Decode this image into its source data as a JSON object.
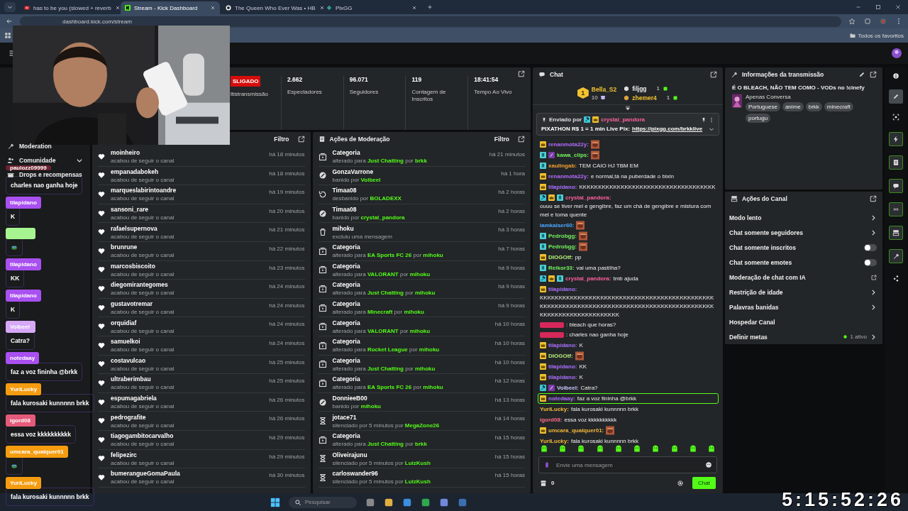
{
  "browser": {
    "tabs": [
      {
        "title": "has to be you (slowed + reverb",
        "selected": false
      },
      {
        "title": "Stream - Kick Dashboard",
        "selected": true
      },
      {
        "title": "The Queen Who Ever Was • HB",
        "selected": false
      },
      {
        "title": "PixGG",
        "selected": false
      }
    ],
    "url": "dashboard.kick.com/stream",
    "bookmarks_label": "Todos os favoritos"
  },
  "sidebar": {
    "items": [
      {
        "label": "Moderation",
        "expandable": false
      },
      {
        "label": "Comunidade",
        "expandable": true
      },
      {
        "label": "Drops e recompensas",
        "expandable": false
      }
    ]
  },
  "stats": {
    "status": {
      "label": "SLIGADO",
      "live": false
    },
    "status_note": "ltistransmissão",
    "items": [
      {
        "value": "2.662",
        "label": "Espectadores"
      },
      {
        "value": "96.071",
        "label": "Seguidores"
      },
      {
        "value": "119",
        "label": "Contagem de Inscritos"
      },
      {
        "value": "18:41:54",
        "label": "Tempo Ao Vivo"
      }
    ]
  },
  "activity": {
    "filter": "Filtro",
    "rows": [
      {
        "user": "moinheiro",
        "action": "acabou de seguir o canal",
        "time": "há 18 minutos"
      },
      {
        "user": "empanadabokeh",
        "action": "acabou de seguir o canal",
        "time": "há 18 minutos"
      },
      {
        "user": "marqueslabirintoandre",
        "action": "acabou de seguir o canal",
        "time": "há 19 minutos"
      },
      {
        "user": "sansoni_rare",
        "action": "acabou de seguir o canal",
        "time": "há 20 minutos"
      },
      {
        "user": "rafaelsupernova",
        "action": "acabou de seguir o canal",
        "time": "há 21 minutos"
      },
      {
        "user": "brunrune",
        "action": "acabou de seguir o canal",
        "time": "há 22 minutos"
      },
      {
        "user": "marcosbiscoito",
        "action": "acabou de seguir o canal",
        "time": "há 23 minutos"
      },
      {
        "user": "diegomirantegomes",
        "action": "acabou de seguir o canal",
        "time": "há 24 minutos"
      },
      {
        "user": "gustavotremar",
        "action": "acabou de seguir o canal",
        "time": "há 24 minutos"
      },
      {
        "user": "orquidiaf",
        "action": "acabou de seguir o canal",
        "time": "há 24 minutos"
      },
      {
        "user": "samuelkoi",
        "action": "acabou de seguir o canal",
        "time": "há 24 minutos"
      },
      {
        "user": "costavulcao",
        "action": "acabou de seguir o canal",
        "time": "há 25 minutos"
      },
      {
        "user": "ultraberimbau",
        "action": "acabou de seguir o canal",
        "time": "há 25 minutos"
      },
      {
        "user": "espumagabriela",
        "action": "acabou de seguir o canal",
        "time": "há 26 minutos"
      },
      {
        "user": "pedrografite",
        "action": "acabou de seguir o canal",
        "time": "há 26 minutos"
      },
      {
        "user": "tiagogambitocarvalho",
        "action": "acabou de seguir o canal",
        "time": "há 29 minutos"
      },
      {
        "user": "felipezirc",
        "action": "acabou de seguir o canal",
        "time": "há 29 minutos"
      },
      {
        "user": "bumerangueGomaPaula",
        "action": "acabou de seguir o canal",
        "time": "há 30 minutos"
      }
    ]
  },
  "moderation": {
    "title": "Ações de Moderação",
    "filter": "Filtro",
    "rows": [
      {
        "kind": "category",
        "title": "Categoria",
        "detail": "alterado para **Just Chatting** por **brkk**",
        "time": "há 21 minutos"
      },
      {
        "kind": "ban",
        "title": "GonzaVarrone",
        "detail": "banido por **Volbeel**",
        "time": "há 1 hora"
      },
      {
        "kind": "unban",
        "title": "Timaa08",
        "detail": "desbanido por **BOLADEXX**",
        "time": "há 2 horas"
      },
      {
        "kind": "ban",
        "title": "Timaa08",
        "detail": "banido por **crystal_pandora**",
        "time": "há 2 horas"
      },
      {
        "kind": "delete",
        "title": "mihoku",
        "detail": "excluiu uma mensagem",
        "time": "há 3 horas"
      },
      {
        "kind": "category",
        "title": "Categoria",
        "detail": "alterado para **EA Sports FC 26** por **mihoku**",
        "time": "há 7 horas"
      },
      {
        "kind": "category",
        "title": "Categoria",
        "detail": "alterado para **VALORANT** por **mihoku**",
        "time": "há 9 horas"
      },
      {
        "kind": "category",
        "title": "Categoria",
        "detail": "alterado para **Just Chatting** por **mihoku**",
        "time": "há 9 horas"
      },
      {
        "kind": "category",
        "title": "Categoria",
        "detail": "alterado para **Minecraft** por **mihoku**",
        "time": "há 9 horas"
      },
      {
        "kind": "category",
        "title": "Categoria",
        "detail": "alterado para **VALORANT** por **mihoku**",
        "time": "há 10 horas"
      },
      {
        "kind": "category",
        "title": "Categoria",
        "detail": "alterado para **Rocket League** por **mihoku**",
        "time": "há 10 horas"
      },
      {
        "kind": "category",
        "title": "Categoria",
        "detail": "alterado para **Just Chatting** por **mihoku**",
        "time": "há 10 horas"
      },
      {
        "kind": "category",
        "title": "Categoria",
        "detail": "alterado para **EA Sports FC 26** por **mihoku**",
        "time": "há 12 horas"
      },
      {
        "kind": "ban",
        "title": "DonnieeB00",
        "detail": "banido por **mihoku**",
        "time": "há 13 horas"
      },
      {
        "kind": "timeout",
        "title": "jotace71",
        "detail": "silenciado por 5 minutos por **MegaZone26**",
        "time": "há 14 horas"
      },
      {
        "kind": "category",
        "title": "Categoria",
        "detail": "alterado para **Just Chatting** por **brkk**",
        "time": "há 15 horas"
      },
      {
        "kind": "timeout",
        "title": "Oliveirajunu",
        "detail": "silenciado por 5 minutos por **LuizKush**",
        "time": "há 15 horas"
      },
      {
        "kind": "timeout",
        "title": "carloswander96",
        "detail": "silenciado por 5 minutos por **LuizKush**",
        "time": "há 15 horas"
      }
    ]
  },
  "chat": {
    "title": "Chat",
    "leaderboard": [
      {
        "rank": "1",
        "user": "Bella_S2",
        "count": "10"
      },
      {
        "user": "filjgg",
        "count": "1"
      },
      {
        "user": "zhemer4",
        "count": "1"
      }
    ],
    "pinned": {
      "label": "Enviado por",
      "badges": [
        {
          "kind": "mod"
        },
        {
          "kind": "crown"
        }
      ],
      "user": "crystal_pandora",
      "color": "#ff5fa0",
      "text": "PIXATHON R$ 1 = 1 min Live Pix:",
      "link": "https://pixgg.com/brkklive"
    },
    "messages": [
      {
        "badges": [
          {
            "kind": "crown"
          }
        ],
        "user": "renanmota22y:",
        "color": "#b36bff",
        "emote": true,
        "highlighted": false
      },
      {
        "badges": [
          {
            "kind": "sub"
          },
          {
            "kind": "other"
          }
        ],
        "user": "kawa_clips:",
        "color": "#72f35e",
        "emote": true,
        "highlighted": false
      },
      {
        "badges": [
          {
            "kind": "sub"
          }
        ],
        "user": "xaulingab:",
        "color": "#f0a030",
        "text": "TEM CAIO HJ TBM EM",
        "highlighted": false
      },
      {
        "badges": [
          {
            "kind": "crown"
          }
        ],
        "user": "renanmota22y:",
        "color": "#b36bff",
        "text": "e normal,tá na puberdade o bixin",
        "highlighted": false
      },
      {
        "badges": [
          {
            "kind": "crown"
          }
        ],
        "user": "tilapidano:",
        "color": "#a970ff",
        "text": "KKKKKKKKKKKKKKKKKKKKKKKKKKKKKKKKKKKK",
        "highlighted": false
      },
      {
        "badges": [
          {
            "kind": "mod"
          },
          {
            "kind": "crown"
          },
          {
            "kind": "sub"
          }
        ],
        "user": "crystal_pandora:",
        "color": "#ff5fa0",
        "text": "ouuu se tiver mel e gengibre, faz um chá de gengibre e mistura com mel e toma quente",
        "highlighted": false
      },
      {
        "user": "iamkaiser60:",
        "color": "#4aa8ff",
        "emote": true,
        "highlighted": false
      },
      {
        "badges": [
          {
            "kind": "sub"
          }
        ],
        "user": "Pedrobgg:",
        "color": "#72f35e",
        "emote": true,
        "highlighted": false
      },
      {
        "badges": [
          {
            "kind": "sub"
          }
        ],
        "user": "Pedrobgg:",
        "color": "#72f35e",
        "emote": true,
        "highlighted": false
      },
      {
        "badges": [
          {
            "kind": "crown"
          }
        ],
        "user": "DIOGOtf:",
        "color": "#b6f07a",
        "text": "pp",
        "highlighted": false
      },
      {
        "badges": [
          {
            "kind": "sub"
          }
        ],
        "user": "Reikor33:",
        "color": "#72f35e",
        "text": "vai uma pastilha?",
        "highlighted": false
      },
      {
        "badges": [
          {
            "kind": "mod"
          },
          {
            "kind": "crown"
          },
          {
            "kind": "sub"
          }
        ],
        "user": "crystal_pandora:",
        "color": "#ff5fa0",
        "text": "tmb ajuda",
        "highlighted": false
      },
      {
        "badges": [
          {
            "kind": "crown"
          }
        ],
        "user": "tilapidano:",
        "color": "#a970ff",
        "text": "KKKKKKKKKKKKKKKKKKKKKKKKKKKKKKKKKKKKKKKKKKKKKKKKKKKKKKKKKKKKKKKKKKKKKKKKKKKKKKKKKKKKKKKKKKKKKKKKKKKKKKKKKKKKKKKKK",
        "highlighted": false
      },
      {
        "blurred": true,
        "color": "#d6285a",
        "text": ": bleach que horas?",
        "highlighted": false
      },
      {
        "blurred": true,
        "color": "#d6285a",
        "text": ": charles nao ganha hoje",
        "highlighted": false
      },
      {
        "badges": [
          {
            "kind": "crown"
          }
        ],
        "user": "tilapidano:",
        "color": "#a970ff",
        "text": "K",
        "highlighted": false
      },
      {
        "badges": [
          {
            "kind": "crown"
          }
        ],
        "user": "DIOGOtf:",
        "color": "#b6f07a",
        "emote": true,
        "highlighted": false
      },
      {
        "badges": [
          {
            "kind": "crown"
          }
        ],
        "user": "tilapidano:",
        "color": "#a970ff",
        "text": "KK",
        "highlighted": false
      },
      {
        "badges": [
          {
            "kind": "crown"
          }
        ],
        "user": "tilapidano:",
        "color": "#a970ff",
        "text": "K",
        "highlighted": false
      },
      {
        "badges": [
          {
            "kind": "mod"
          },
          {
            "kind": "other"
          }
        ],
        "user": "Volbeel:",
        "color": "#c8c8ff",
        "text": "Catra?",
        "highlighted": false
      },
      {
        "badges": [
          {
            "kind": "crown"
          }
        ],
        "user": "notedaay:",
        "color": "#a970ff",
        "text": "faz a voz fininha @brkk",
        "highlighted": true
      },
      {
        "user": "YuriLucky:",
        "color": "#f5b83b",
        "text": "fala kurosaki kunnnnn brkk",
        "highlighted": false
      },
      {
        "user": "igord08:",
        "color": "#ff6b8a",
        "text": "essa voz kkkkkkkkkk",
        "highlighted": false
      },
      {
        "badges": [
          {
            "kind": "crown"
          }
        ],
        "user": "umcara_qualquer01:",
        "color": "#f5b83b",
        "emote": true,
        "highlighted": false
      },
      {
        "user": "YuriLucky:",
        "color": "#f5b83b",
        "text": "fala kurosaki kunnnnn brkk",
        "highlighted": false
      }
    ],
    "input": {
      "placeholder": "Envie uma mensagem"
    },
    "points": "0",
    "send": "Chat"
  },
  "stream_info": {
    "title": "Informações da transmissão",
    "stream_title": "É O BLEACH, NÃO TEM COMO - VODs no !cinefy",
    "category": "Apenas Conversa",
    "tags": [
      "Portuguese",
      "anime",
      "brkk",
      "minecraft",
      "portugu"
    ]
  },
  "channel_actions": {
    "title": "Ações do Canal",
    "items": [
      {
        "label": "Modo lento",
        "kind": "arrow"
      },
      {
        "label": "Chat somente seguidores",
        "kind": "arrow"
      },
      {
        "label": "Chat somente inscritos",
        "kind": "toggle",
        "on": false
      },
      {
        "label": "Chat somente emotes",
        "kind": "toggle",
        "on": false
      },
      {
        "label": "Moderação de chat com IA",
        "kind": "external"
      },
      {
        "label": "Restrição de idade",
        "kind": "arrow"
      },
      {
        "label": "Palavras banidas",
        "kind": "arrow"
      },
      {
        "label": "Hospedar Canal",
        "kind": "plain"
      },
      {
        "label": "Definir metas",
        "kind": "count",
        "count": "1 ativo"
      }
    ]
  },
  "rail": [
    {
      "selected": false,
      "pinned": false
    },
    {
      "selected": true,
      "pinned": false
    },
    {
      "selected": false,
      "pinned": false
    },
    {
      "selected": false,
      "pinned": true
    },
    {
      "selected": false,
      "pinned": true
    },
    {
      "selected": false,
      "pinned": true
    },
    {
      "selected": false,
      "pinned": true
    },
    {
      "selected": false,
      "pinned": true
    },
    {
      "selected": false,
      "pinned": true
    },
    {
      "selected": false,
      "pinned": false
    }
  ],
  "overlay_chat": [
    {
      "user": "paulozz09999",
      "color": "#6e2230",
      "text": "charles nao ganha hoje"
    },
    {
      "user": "tilapidano",
      "color": "#a950f0",
      "text": "K"
    },
    {
      "blurred": true,
      "color": "#a6f590",
      "emote": true
    },
    {
      "user": "tilapidano",
      "color": "#a950f0",
      "text": "KK"
    },
    {
      "user": "tilapidano",
      "color": "#a950f0",
      "text": "K"
    },
    {
      "user": "Volbeel",
      "color": "#d6a8f5",
      "text": "Catra?"
    },
    {
      "user": "notedaay",
      "color": "#a950f0",
      "text": "faz a voz fininha @brkk"
    },
    {
      "user": "YuriLucky",
      "color": "#f59c10",
      "text": "fala kurosaki kunnnnn brkk"
    },
    {
      "user": "igord08",
      "color": "#e55a7a",
      "text": "essa voz kkkkkkkkkk"
    },
    {
      "user": "umcara_qualquer01",
      "color": "#f59c10",
      "emote": true
    },
    {
      "user": "YuriLucky",
      "color": "#f59c10",
      "text": "fala kurosaki kunnnnn brkk"
    }
  ],
  "overlay_timer": "5:15:52:26",
  "taskbar": {
    "search": {
      "placeholder": "Pesquisar"
    }
  }
}
